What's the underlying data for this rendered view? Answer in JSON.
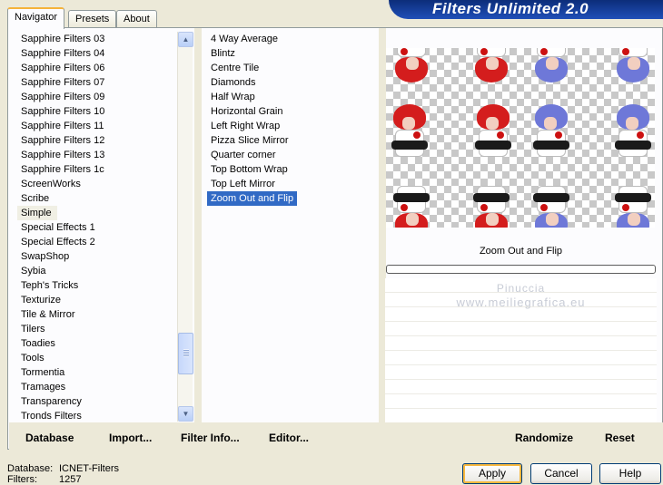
{
  "tabs": [
    "Navigator",
    "Presets",
    "About"
  ],
  "app_title": "Filters Unlimited 2.0",
  "categories": [
    "Sapphire Filters 03",
    "Sapphire Filters 04",
    "Sapphire Filters 06",
    "Sapphire Filters 07",
    "Sapphire Filters 09",
    "Sapphire Filters 10",
    "Sapphire Filters 11",
    "Sapphire Filters 12",
    "Sapphire Filters 13",
    "Sapphire Filters 1c",
    "ScreenWorks",
    "Scribe",
    "Simple",
    "Special Effects 1",
    "Special Effects 2",
    "SwapShop",
    "Sybia",
    "Teph's Tricks",
    "Texturize",
    "Tile & Mirror",
    "Tilers",
    "Toadies",
    "Tools",
    "Tormentia",
    "Tramages",
    "Transparency",
    "Tronds Filters"
  ],
  "highlighted_category": "Simple",
  "filters": [
    "4 Way Average",
    "Blintz",
    "Centre Tile",
    "Diamonds",
    "Half Wrap",
    "Horizontal Grain",
    "Left Right Wrap",
    "Pizza Slice Mirror",
    "Quarter corner",
    "Top Bottom Wrap",
    "Top Left Mirror",
    "Zoom Out and Flip"
  ],
  "selected_filter": "Zoom Out and Flip",
  "preview": {
    "title": "Zoom Out and Flip",
    "watermark_line1": "Pinuccia",
    "watermark_line2": "www.meiliegrafica.eu",
    "progress": 0
  },
  "toolbar": {
    "database": "Database",
    "import": "Import...",
    "filter_info": "Filter Info...",
    "editor": "Editor...",
    "randomize": "Randomize",
    "reset": "Reset"
  },
  "status": {
    "database_label": "Database:",
    "database_value": "ICNET-Filters",
    "filters_label": "Filters:",
    "filters_value": "1257"
  },
  "buttons": {
    "apply": "Apply",
    "cancel": "Cancel",
    "help": "Help"
  },
  "icons": {
    "scroll_up": "chevron-up-icon",
    "scroll_down": "chevron-down-icon"
  }
}
